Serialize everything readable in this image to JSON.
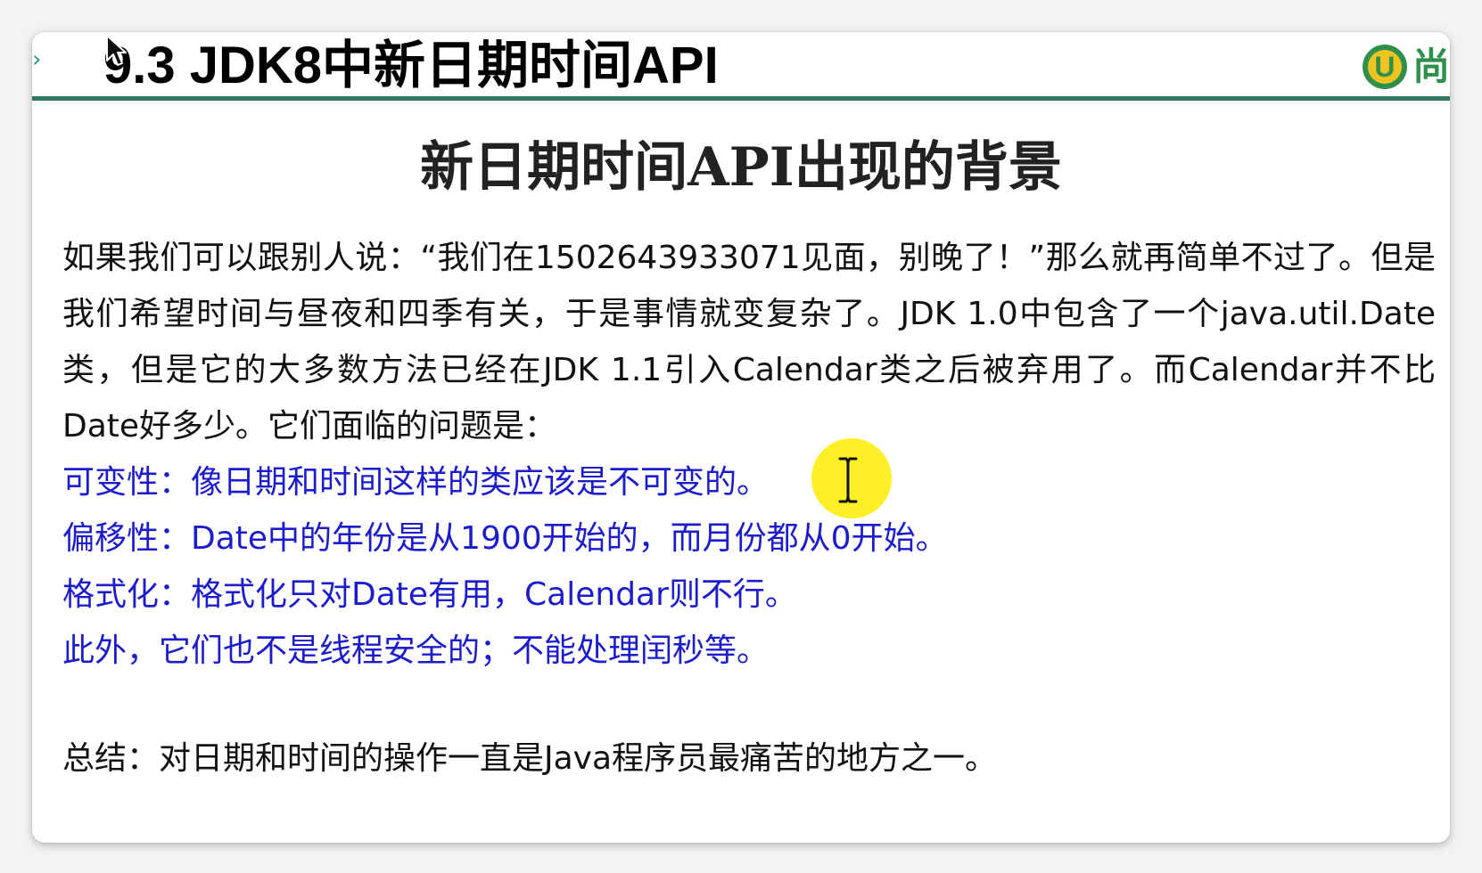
{
  "slide": {
    "section_title": "9.3 JDK8中新日期时间API",
    "logo_text": "尚",
    "heading": "新日期时间API出现的背景",
    "paragraph": "如果我们可以跟别人说：“我们在1502643933071见面，别晚了！”那么就再简单不过了。但是我们希望时间与昼夜和四季有关，于是事情就变复杂了。JDK 1.0中包含了一个java.util.Date类，但是它的大多数方法已经在JDK 1.1引入Calendar类之后被弃用了。而Calendar并不比Date好多少。它们面临的问题是：",
    "points": [
      "可变性：像日期和时间这样的类应该是不可变的。",
      "偏移性：Date中的年份是从1900开始的，而月份都从0开始。",
      "格式化：格式化只对Date有用，Calendar则不行。",
      "此外，它们也不是线程安全的；不能处理闰秒等。"
    ],
    "summary": "总结：对日期和时间的操作一直是Java程序员最痛苦的地方之一。"
  },
  "colors": {
    "header_line": "#2c7a64",
    "point_text": "#1c1ccc",
    "logo_green": "#2f8f4d",
    "logo_yellow": "#f0c420",
    "cursor_highlight": "#ffec00"
  },
  "icons": {
    "header_arrow": "chevron-right-icon",
    "logo": "logo-icon",
    "text_cursor": "i-beam-cursor-icon",
    "pointer_cursor": "arrow-pointer-icon"
  }
}
